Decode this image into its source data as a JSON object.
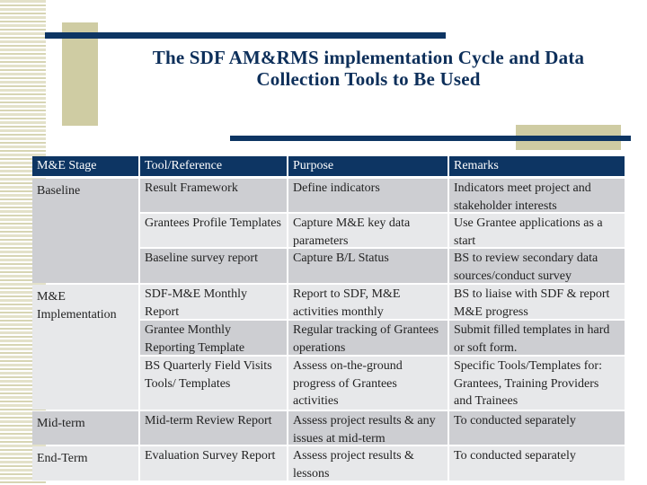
{
  "slide": {
    "title_line1": "The SDF AM&RMS implementation Cycle and Data",
    "title_line2": "Collection Tools to Be Used",
    "colors": {
      "navy": "#0d3563",
      "beige": "#cfcca3",
      "row_dark": "#cdced2",
      "row_light": "#e7e8ea"
    }
  },
  "table": {
    "headers": [
      "M&E Stage",
      "Tool/Reference",
      "Purpose",
      "Remarks"
    ],
    "groups": [
      {
        "stage": "Baseline",
        "rows": [
          {
            "tool": "Result Framework",
            "purpose": "Define indicators",
            "remarks": "Indicators meet project and stakeholder interests"
          },
          {
            "tool": "Grantees Profile Templates",
            "purpose": "Capture M&E key data parameters",
            "remarks": "Use Grantee applications as a start"
          },
          {
            "tool": "Baseline survey report",
            "purpose": "Capture B/L Status",
            "remarks": "BS to review secondary data sources/conduct survey"
          }
        ]
      },
      {
        "stage": "M&E Implementation",
        "rows": [
          {
            "tool": "SDF-M&E Monthly Report",
            "purpose": "Report to SDF, M&E activities monthly",
            "remarks": "BS to liaise with SDF & report M&E progress"
          },
          {
            "tool": "Grantee Monthly Reporting Template",
            "purpose": "Regular tracking of Grantees operations",
            "remarks": "Submit filled templates in hard or soft form."
          },
          {
            "tool": "BS Quarterly Field Visits Tools/ Templates",
            "purpose": "Assess on-the-ground progress of Grantees activities",
            "remarks": "Specific Tools/Templates for: Grantees, Training Providers and Trainees"
          }
        ]
      },
      {
        "stage": "Mid-term",
        "rows": [
          {
            "tool": "Mid-term Review Report",
            "purpose": "Assess project results & any issues at mid-term",
            "remarks": "To conducted separately"
          }
        ]
      },
      {
        "stage": "End-Term",
        "rows": [
          {
            "tool": "Evaluation Survey Report",
            "purpose": "Assess project results & lessons",
            "remarks": "To conducted separately"
          }
        ]
      }
    ]
  }
}
